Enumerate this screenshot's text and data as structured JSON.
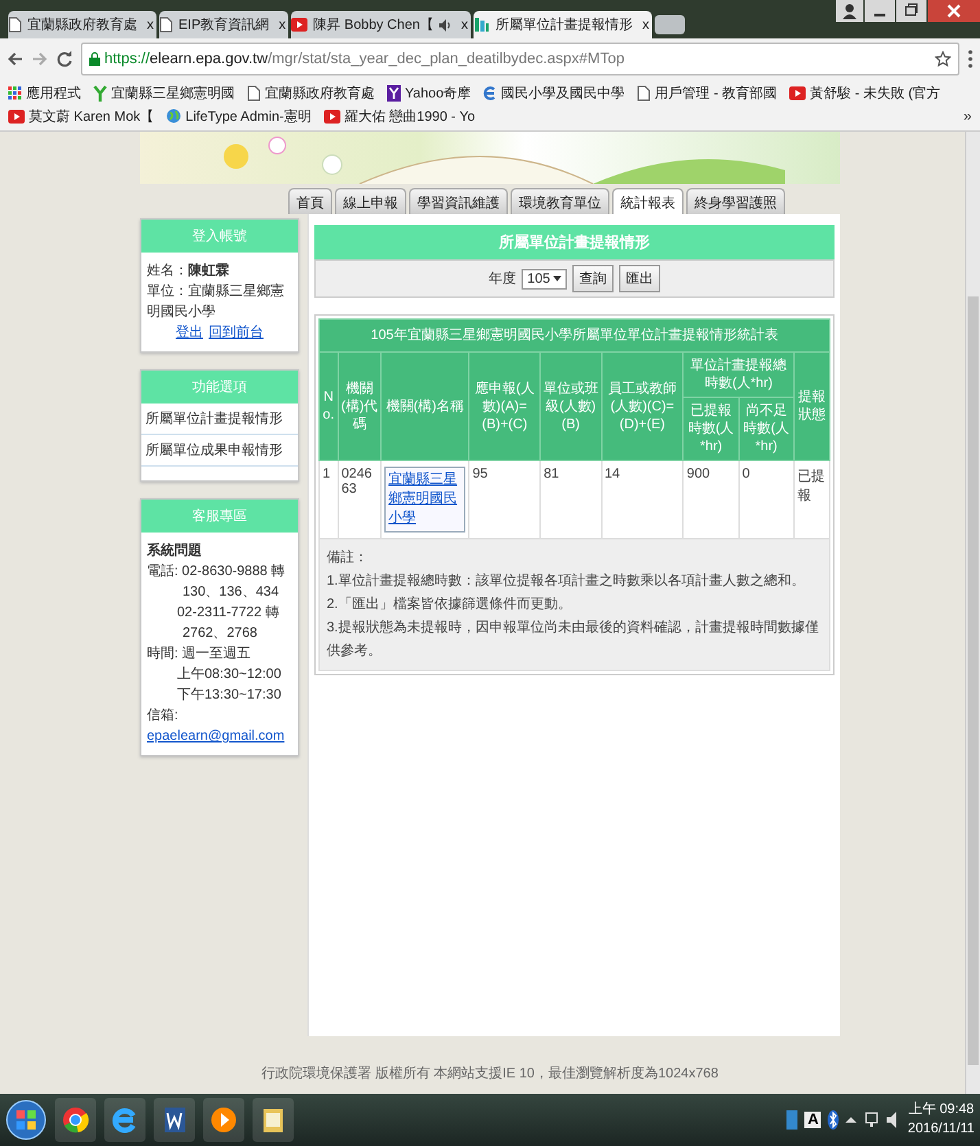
{
  "browser": {
    "tabs": [
      {
        "title": "宜蘭縣政府教育處",
        "kind": "page",
        "audio": false,
        "close": "x",
        "selected": false
      },
      {
        "title": "EIP教育資訊網",
        "kind": "page",
        "audio": false,
        "close": "x",
        "selected": false
      },
      {
        "title": "陳昇 Bobby Chen【",
        "kind": "video",
        "audio": true,
        "close": "x",
        "selected": false
      },
      {
        "title": "所屬單位計畫提報情形",
        "kind": "site",
        "audio": false,
        "close": "x",
        "selected": true
      }
    ],
    "address": {
      "scheme": "https://",
      "host": "elearn.epa.gov.tw",
      "path": "/mgr/stat/sta_year_dec_plan_deatilbydec.aspx#MTop"
    },
    "bookmarks": [
      {
        "label": "應用程式",
        "kind": "apps"
      },
      {
        "label": "宜蘭縣三星鄉憲明國",
        "kind": "leaf"
      },
      {
        "label": "宜蘭縣政府教育處",
        "kind": "page"
      },
      {
        "label": "Yahoo奇摩",
        "kind": "yahoo"
      },
      {
        "label": "國民小學及國民中學",
        "kind": "edu"
      },
      {
        "label": "用戶管理 - 教育部國",
        "kind": "page"
      },
      {
        "label": "黃舒駿 - 未失敗 (官方",
        "kind": "video"
      },
      {
        "label": "莫文蔚 Karen Mok【",
        "kind": "video"
      },
      {
        "label": "LifeType Admin-憲明",
        "kind": "globe"
      },
      {
        "label": "羅大佑 戀曲1990 - Yo",
        "kind": "video"
      }
    ],
    "bookmarks_more": "»"
  },
  "nav": [
    {
      "label": "首頁",
      "selected": false
    },
    {
      "label": "線上申報",
      "selected": false
    },
    {
      "label": "學習資訊維護",
      "selected": false
    },
    {
      "label": "環境教育單位",
      "selected": false
    },
    {
      "label": "統計報表",
      "selected": true
    },
    {
      "label": "終身學習護照",
      "selected": false
    }
  ],
  "sidebar": {
    "login": {
      "title": "登入帳號",
      "name": "姓名：**陳虹霖**",
      "unit": "單位：宜蘭縣三星鄉憲明國民小學",
      "links": [
        "登出",
        "回到前台"
      ]
    },
    "functions": {
      "title": "功能選項",
      "items": [
        "所屬單位計畫提報情形",
        "所屬單位成果申報情形"
      ]
    },
    "support": {
      "title": "客服專區",
      "heading": "系統問題",
      "lines": [
        "電話: 02-8630-9888 轉",
        "130、136、434",
        "02-2311-7722 轉",
        "2762、2768",
        "時間: 週一至週五",
        "上午08:30~12:00",
        "下午13:30~17:30"
      ],
      "email_label": "信箱:",
      "email": "epaelearn@gmail.com"
    }
  },
  "main": {
    "title": "所屬單位計畫提報情形",
    "filter": {
      "label": "年度",
      "year": "105",
      "buttons": [
        "查詢",
        "匯出"
      ]
    },
    "table": {
      "caption": "105年宜蘭縣三星鄉憲明國民小學所屬單位單位計畫提報情形統計表",
      "columns": [
        {
          "label": "No."
        },
        {
          "label": "機關(構)代碼"
        },
        {
          "label": "機關(構)名稱"
        },
        {
          "label": "應申報(人數)(A)=(B)+(C)"
        },
        {
          "label": "單位或班級(人數)(B)"
        },
        {
          "label": "員工或教師(人數)(C)=(D)+(E)"
        },
        {
          "label": "單位計畫提報總時數(人*hr)",
          "colspan": 2,
          "children": [
            {
              "label": "已提報時數(人*hr)"
            },
            {
              "label": "尚不足時數(人*hr)"
            }
          ]
        },
        {
          "label": "提報狀態"
        }
      ],
      "rows": [
        [
          {
            "text": "1",
            "kind": "text"
          },
          {
            "text": "024663",
            "kind": "text"
          },
          {
            "text": "宜蘭縣三星鄉憲明國民小學",
            "kind": "link"
          },
          {
            "text": "95",
            "kind": "text"
          },
          {
            "text": "81",
            "kind": "text"
          },
          {
            "text": "14",
            "kind": "text"
          },
          {
            "text": "900",
            "kind": "text"
          },
          {
            "text": "0",
            "kind": "text"
          },
          {
            "text": "已提報",
            "kind": "text"
          }
        ]
      ],
      "notes_title": "備註：",
      "notes": [
        "1.單位計畫提報總時數：該單位提報各項計畫之時數乘以各項計畫人數之總和。",
        "2.「匯出」檔案皆依據篩選條件而更動。",
        "3.提報狀態為未提報時，因申報單位尚未由最後的資料確認，計畫提報時間數據僅供參考。"
      ]
    }
  },
  "footer": "行政院環境保護署 版權所有 本網站支援IE 10，最佳瀏覽解析度為1024x768",
  "taskbar": {
    "apps": [
      {
        "kind": "chrome"
      },
      {
        "kind": "ie"
      },
      {
        "kind": "word"
      },
      {
        "kind": "media"
      },
      {
        "kind": "file"
      }
    ],
    "ime": "A",
    "time": "上午 09:48",
    "date": "2016/11/11"
  }
}
